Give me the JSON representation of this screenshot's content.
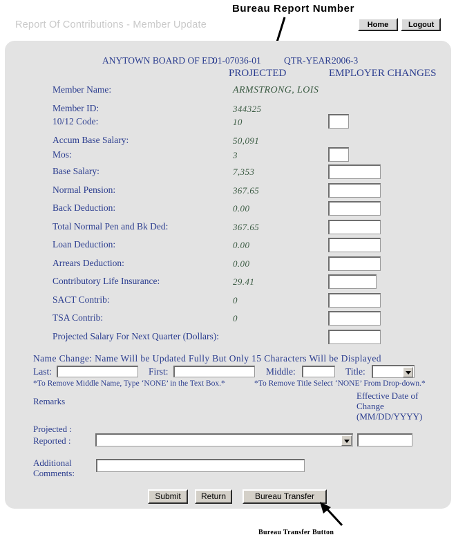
{
  "annotations": {
    "top_label": "Bureau Report Number",
    "bottom_label": "Bureau Transfer Button"
  },
  "titlebar": {
    "app_title": "Report Of Contributions - Member Update",
    "home_label": "Home",
    "logout_label": "Logout"
  },
  "header": {
    "organization": "ANYTOWN BOARD OF ED.",
    "bureau_report_number": "01-07036-01",
    "qtr_year_label": "QTR-YEAR:",
    "qtr_year_value": "2006-3",
    "col_projected": "PROJECTED",
    "col_employer_changes": "EMPLOYER CHANGES"
  },
  "rows": [
    {
      "label": "Member Name:",
      "value": "ARMSTRONG, LOIS",
      "input": "none",
      "input_value": ""
    },
    {
      "label": "Member ID:",
      "value": "344325",
      "input": "none",
      "input_value": ""
    },
    {
      "label": "10/12 Code:",
      "value": "10",
      "input": "sm",
      "input_value": ""
    },
    {
      "label": "Accum Base Salary:",
      "value": "50,091",
      "input": "none",
      "input_value": ""
    },
    {
      "label": "Mos:",
      "value": "3",
      "input": "sm",
      "input_value": ""
    },
    {
      "label": "Base Salary:",
      "value": "7,353",
      "input": "lg",
      "input_value": ""
    },
    {
      "label": "Normal Pension:",
      "value": "367.65",
      "input": "lg",
      "input_value": ""
    },
    {
      "label": "Back Deduction:",
      "value": "0.00",
      "input": "lg",
      "input_value": ""
    },
    {
      "label": "Total Normal Pen and Bk Ded:",
      "value": "367.65",
      "input": "lg",
      "input_value": ""
    },
    {
      "label": "Loan Deduction:",
      "value": "0.00",
      "input": "lg",
      "input_value": ""
    },
    {
      "label": "Arrears Deduction:",
      "value": "0.00",
      "input": "lg",
      "input_value": ""
    },
    {
      "label": "Contributory Life Insurance:",
      "value": "29.41",
      "input": "md",
      "input_value": ""
    },
    {
      "label": "SACT Contrib:",
      "value": "0",
      "input": "lg",
      "input_value": ""
    },
    {
      "label": "TSA Contrib:",
      "value": "0",
      "input": "lg",
      "input_value": ""
    },
    {
      "label": "Projected Salary For Next Quarter (Dollars):",
      "value": "",
      "input": "lg",
      "input_value": ""
    }
  ],
  "name_change": {
    "heading": "Name  Change:  Name Will be Updated Fully But Only 15 Characters Will be Displayed",
    "last_label": "Last:",
    "last_value": "",
    "first_label": "First:",
    "first_value": "",
    "middle_label": "Middle:",
    "middle_value": "",
    "title_label": "Title:",
    "title_selected": "",
    "title_options": [
      ""
    ],
    "note_middle": "*To Remove Middle Name, Type ‘NONE’ in the Text Box.*",
    "note_title": "*To Remove Title Select ‘NONE’ From Drop-down.*"
  },
  "remarks": {
    "remarks_label": "Remarks",
    "projected_label": "Projected :",
    "reported_label": "Reported :",
    "reported_selected": "",
    "reported_options": [
      ""
    ],
    "effective_date_line1": "Effective Date of",
    "effective_date_line2": "Change",
    "effective_date_line3": "(MM/DD/YYYY)",
    "effective_date_value": "",
    "additional_label_line1": "Additional",
    "additional_label_line2": "Comments:",
    "additional_value": ""
  },
  "actions": {
    "submit_label": "Submit",
    "return_label": "Return",
    "bureau_transfer_label": "Bureau Transfer"
  },
  "colors": {
    "label_blue": "#2b3d8f",
    "value_green": "#3c5c44",
    "panel_bg": "#e3e3e3",
    "title_gray": "#c9c9c9"
  }
}
